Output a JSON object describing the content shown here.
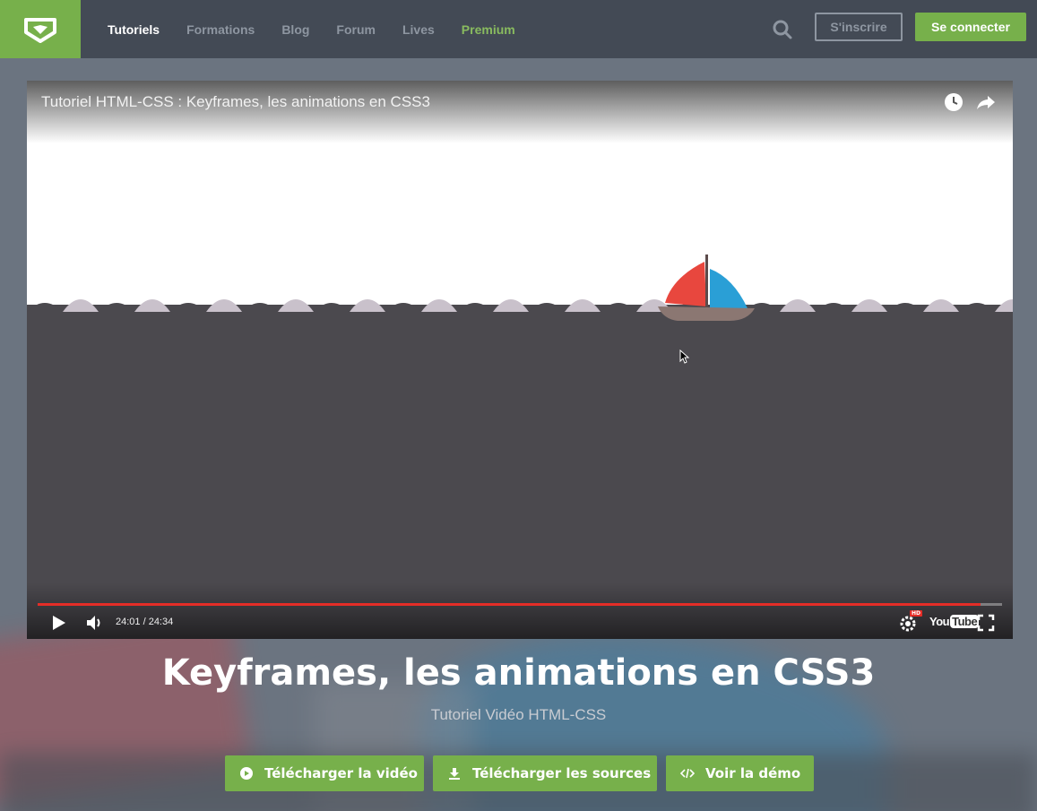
{
  "header": {
    "logo": "grafikart-logo",
    "nav": [
      {
        "label": "Tutoriels",
        "active": true
      },
      {
        "label": "Formations"
      },
      {
        "label": "Blog"
      },
      {
        "label": "Forum"
      },
      {
        "label": "Lives"
      },
      {
        "label": "Premium",
        "highlight": true
      }
    ],
    "signup_label": "S'inscrire",
    "login_label": "Se connecter"
  },
  "player": {
    "video_title": "Tutoriel HTML-CSS : Keyframes, les animations en CSS3",
    "timecode": "24:01 / 24:34",
    "progress": 0.978,
    "hd_badge": "HD",
    "youtube_label_a": "You",
    "youtube_label_b": "Tube"
  },
  "page": {
    "title": "Keyframes, les animations en CSS3",
    "subtitle": "Tutoriel Vidéo HTML-CSS"
  },
  "actions": [
    {
      "label": "Télécharger la vidéo",
      "icon": "play-circle-icon"
    },
    {
      "label": "Télécharger les sources",
      "icon": "download-icon"
    },
    {
      "label": "Voir la démo",
      "icon": "code-icon"
    }
  ],
  "colors": {
    "brand_green": "#77b04b",
    "header_bg": "#434a55",
    "progress_red": "#e52d27"
  }
}
